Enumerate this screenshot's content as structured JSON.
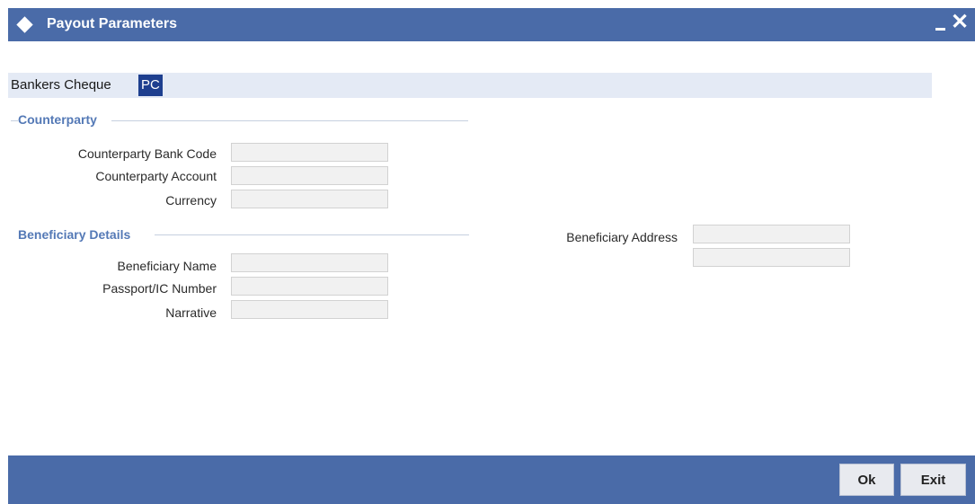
{
  "window": {
    "title": "Payout Parameters",
    "minimize_icon": "minimize-icon",
    "close_icon": "close-icon",
    "close_glyph": "✕"
  },
  "tabs": [
    {
      "label": "Bankers Cheque",
      "active": false
    },
    {
      "label": "PC",
      "active": true
    }
  ],
  "counterparty": {
    "heading": "Counterparty",
    "bank_code_label": "Counterparty Bank Code",
    "bank_code_value": "",
    "account_label": "Counterparty Account",
    "account_value": "",
    "currency_label": "Currency",
    "currency_value": ""
  },
  "beneficiary": {
    "heading": "Beneficiary Details",
    "name_label": "Beneficiary Name",
    "name_value": "",
    "passport_label": "Passport/IC Number",
    "passport_value": "",
    "narrative_label": "Narrative",
    "narrative_value": "",
    "address_label": "Beneficiary Address",
    "address_line1_value": "",
    "address_line2_value": ""
  },
  "footer": {
    "ok_label": "Ok",
    "exit_label": "Exit"
  },
  "colors": {
    "titlebar": "#4a6ba8",
    "active_tab": "#1e3f8f",
    "section_heading": "#5479b6"
  }
}
